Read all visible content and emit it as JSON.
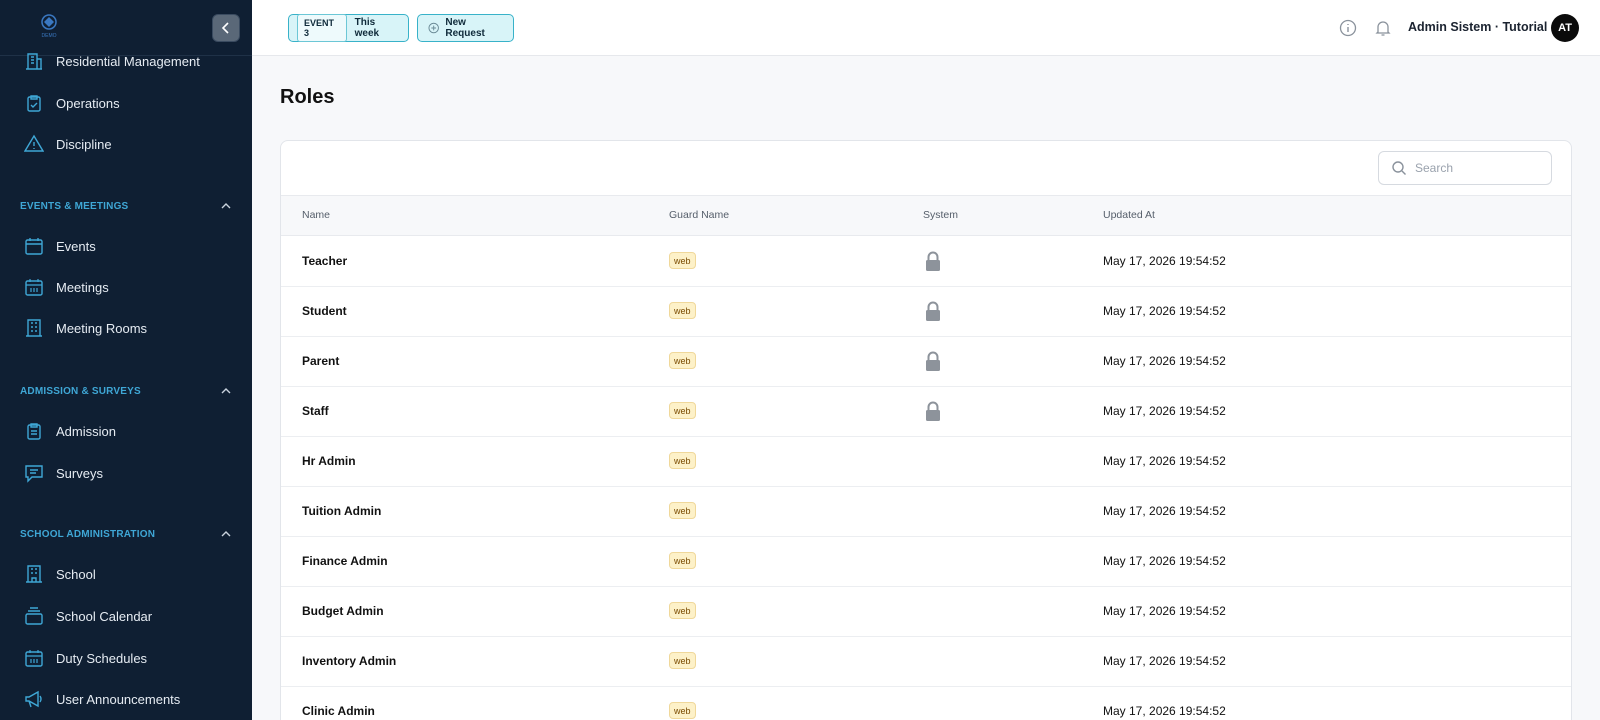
{
  "sidebar": {
    "logo_text": "DEMO",
    "items_top": [
      {
        "label": "Residential Management",
        "icon": "building-icon"
      },
      {
        "label": "Operations",
        "icon": "clipboard-check-icon"
      },
      {
        "label": "Discipline",
        "icon": "warning-icon"
      }
    ],
    "sections": [
      {
        "title": "EVENTS & MEETINGS",
        "items": [
          {
            "label": "Events",
            "icon": "calendar-icon"
          },
          {
            "label": "Meetings",
            "icon": "calendar-grid-icon"
          },
          {
            "label": "Meeting Rooms",
            "icon": "building-icon"
          }
        ]
      },
      {
        "title": "ADMISSION & SURVEYS",
        "items": [
          {
            "label": "Admission",
            "icon": "clipboard-icon"
          },
          {
            "label": "Surveys",
            "icon": "chat-icon"
          }
        ]
      },
      {
        "title": "SCHOOL ADMINISTRATION",
        "items": [
          {
            "label": "School",
            "icon": "building-icon"
          },
          {
            "label": "School Calendar",
            "icon": "stack-icon"
          },
          {
            "label": "Duty Schedules",
            "icon": "calendar-grid-icon"
          },
          {
            "label": "User Announcements",
            "icon": "megaphone-icon"
          }
        ]
      }
    ]
  },
  "topbar": {
    "event_tag": "EVENT 3",
    "event_label": "This week",
    "new_request_label": "New Request",
    "user_name": "Admin Sistem · Tutorial",
    "avatar_initials": "AT"
  },
  "main": {
    "title": "Roles",
    "search_placeholder": "Search",
    "columns": [
      "Name",
      "Guard Name",
      "System",
      "Updated At"
    ],
    "rows": [
      {
        "name": "Teacher",
        "guard": "web",
        "system": true,
        "updated": "May 17, 2026 19:54:52"
      },
      {
        "name": "Student",
        "guard": "web",
        "system": true,
        "updated": "May 17, 2026 19:54:52"
      },
      {
        "name": "Parent",
        "guard": "web",
        "system": true,
        "updated": "May 17, 2026 19:54:52"
      },
      {
        "name": "Staff",
        "guard": "web",
        "system": true,
        "updated": "May 17, 2026 19:54:52"
      },
      {
        "name": "Hr Admin",
        "guard": "web",
        "system": false,
        "updated": "May 17, 2026 19:54:52"
      },
      {
        "name": "Tuition Admin",
        "guard": "web",
        "system": false,
        "updated": "May 17, 2026 19:54:52"
      },
      {
        "name": "Finance Admin",
        "guard": "web",
        "system": false,
        "updated": "May 17, 2026 19:54:52"
      },
      {
        "name": "Budget Admin",
        "guard": "web",
        "system": false,
        "updated": "May 17, 2026 19:54:52"
      },
      {
        "name": "Inventory Admin",
        "guard": "web",
        "system": false,
        "updated": "May 17, 2026 19:54:52"
      },
      {
        "name": "Clinic Admin",
        "guard": "web",
        "system": false,
        "updated": "May 17, 2026 19:54:52"
      }
    ]
  },
  "colors": {
    "sidebar_bg": "#0f1f33",
    "accent": "#3fa7d6",
    "pill_bg": "#d8f4f8",
    "badge_bg": "#fdf1c8"
  }
}
